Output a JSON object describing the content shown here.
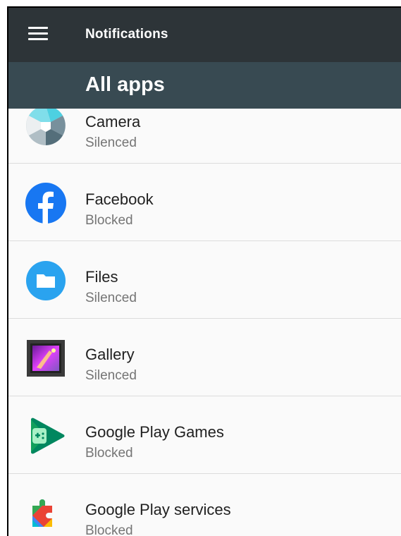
{
  "toolbar": {
    "title": "Notifications",
    "menu_icon": "hamburger-menu-icon"
  },
  "subheader": {
    "title": "All apps"
  },
  "apps": [
    {
      "name": "Camera",
      "status": "Silenced",
      "icon": "camera-icon"
    },
    {
      "name": "Facebook",
      "status": "Blocked",
      "icon": "facebook-icon"
    },
    {
      "name": "Files",
      "status": "Silenced",
      "icon": "files-icon"
    },
    {
      "name": "Gallery",
      "status": "Silenced",
      "icon": "gallery-icon"
    },
    {
      "name": "Google Play Games",
      "status": "Blocked",
      "icon": "google-play-games-icon"
    },
    {
      "name": "Google Play services",
      "status": "Blocked",
      "icon": "google-play-services-icon"
    }
  ],
  "colors": {
    "toolbar": "#2d3438",
    "subheader": "#384a52",
    "facebook": "#1877f2",
    "files": "#2aa3ef"
  }
}
